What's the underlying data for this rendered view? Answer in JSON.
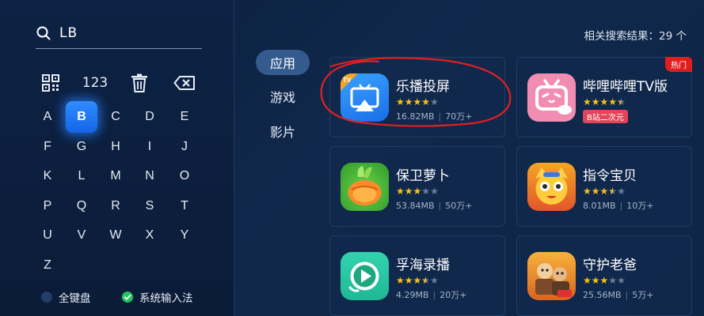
{
  "search": {
    "query": "LB"
  },
  "keyboard": {
    "num_key": "123",
    "rows": [
      [
        "A",
        "B",
        "C",
        "D",
        "E"
      ],
      [
        "F",
        "G",
        "H",
        "I",
        "J"
      ],
      [
        "K",
        "L",
        "M",
        "N",
        "O"
      ],
      [
        "P",
        "Q",
        "R",
        "S",
        "T"
      ],
      [
        "U",
        "V",
        "W",
        "X",
        "Y"
      ],
      [
        "Z"
      ]
    ],
    "selected": "B",
    "options": [
      {
        "label": "全键盘",
        "checked": false
      },
      {
        "label": "系统输入法",
        "checked": true
      }
    ]
  },
  "categories": [
    {
      "label": "应用",
      "active": true
    },
    {
      "label": "游戏",
      "active": false
    },
    {
      "label": "影片",
      "active": false
    }
  ],
  "result_count": "相关搜索结果：29 个",
  "apps": [
    {
      "name": "乐播投屏",
      "rating": 4,
      "size": "16.82MB",
      "downloads": "70万+",
      "icon": "lebo-tv-cast-icon"
    },
    {
      "name": "哔哩哔哩TV版",
      "rating": 4.5,
      "badge": "热门",
      "tag": "B站二次元",
      "icon": "bilibili-tv-icon"
    },
    {
      "name": "保卫萝卜",
      "rating": 3,
      "size": "53.84MB",
      "downloads": "50万+",
      "icon": "carrot-game-icon"
    },
    {
      "name": "指令宝贝",
      "rating": 3.5,
      "size": "8.01MB",
      "downloads": "10万+",
      "icon": "cat-mascot-icon"
    },
    {
      "name": "孚海录播",
      "rating": 3.5,
      "size": "4.29MB",
      "downloads": "20万+",
      "icon": "play-button-icon"
    },
    {
      "name": "守护老爸",
      "rating": 3,
      "size": "25.56MB",
      "downloads": "5万+",
      "icon": "movie-poster-icon"
    }
  ],
  "colors": {
    "accent": "#1f7bff",
    "star": "#f7c31a",
    "hot": "#e01e1e",
    "annotation": "#e02020"
  }
}
